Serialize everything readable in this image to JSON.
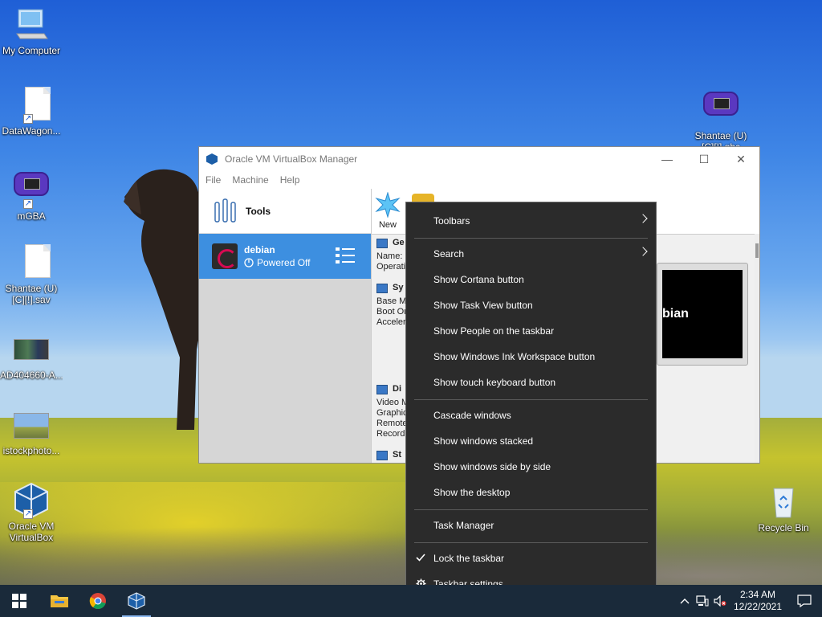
{
  "desktop": {
    "icons": [
      {
        "label": "My Computer",
        "icon": "computer-icon"
      },
      {
        "label": "DataWagon...",
        "icon": "document-icon"
      },
      {
        "label": "mGBA",
        "icon": "gameboy-icon"
      },
      {
        "label": "Shantae (U)",
        "label2": "[C][!].sav",
        "icon": "document-icon"
      },
      {
        "label": "AD404660-A...",
        "icon": "image-icon"
      },
      {
        "label": "istockphoto...",
        "icon": "image-icon"
      },
      {
        "label": "Oracle VM",
        "label2": "VirtualBox",
        "icon": "virtualbox-icon"
      },
      {
        "label": "Shantae (U)",
        "label2": "[C][!].gbc",
        "icon": "gameboy-icon"
      },
      {
        "label": "Recycle Bin",
        "icon": "recycle-bin-icon"
      }
    ]
  },
  "vbox": {
    "title": "Oracle VM VirtualBox Manager",
    "menu": [
      "File",
      "Machine",
      "Help"
    ],
    "tools_label": "Tools",
    "vm": {
      "name": "debian",
      "state": "Powered Off"
    },
    "toolbar": {
      "new_label": "New"
    },
    "details": {
      "general": {
        "heading": "Ge",
        "lines": [
          "Name:",
          "Operati"
        ]
      },
      "system": {
        "heading": "Sy",
        "lines": [
          "Base M",
          "Boot Or",
          "Acceler"
        ]
      },
      "display": {
        "heading": "Di",
        "lines": [
          "Video M",
          "Graphic",
          "Remote",
          "Recordi"
        ]
      },
      "storage": {
        "heading": "St"
      }
    },
    "preview_text": "bian"
  },
  "context_menu": {
    "items": [
      {
        "label": "Toolbars",
        "submenu": true
      },
      {
        "label": "Search",
        "submenu": true
      },
      {
        "label": "Show Cortana button"
      },
      {
        "label": "Show Task View button"
      },
      {
        "label": "Show People on the taskbar"
      },
      {
        "label": "Show Windows Ink Workspace button"
      },
      {
        "label": "Show touch keyboard button"
      },
      {
        "label": "Cascade windows"
      },
      {
        "label": "Show windows stacked"
      },
      {
        "label": "Show windows side by side"
      },
      {
        "label": "Show the desktop"
      },
      {
        "label": "Task Manager"
      },
      {
        "label": "Lock the taskbar",
        "checked": true
      },
      {
        "label": "Taskbar settings",
        "icon": "gear-icon"
      }
    ]
  },
  "taskbar": {
    "apps": [
      "File Explorer",
      "Google Chrome",
      "Oracle VM VirtualBox"
    ],
    "clock": {
      "time": "2:34 AM",
      "date": "12/22/2021"
    }
  },
  "colors": {
    "taskbar_bg": "#1a2a3a",
    "menu_bg": "#2b2b2b",
    "selection": "#3d8fe0"
  }
}
